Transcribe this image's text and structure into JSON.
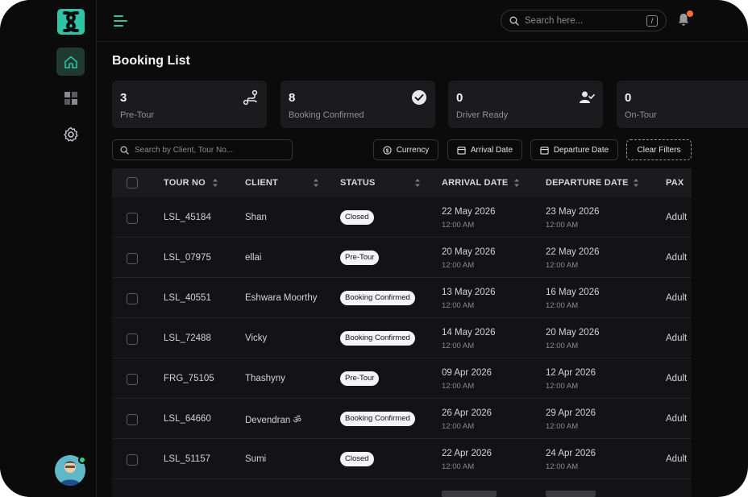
{
  "app": {
    "search_placeholder": "Search here...",
    "shortcut_key": "/"
  },
  "page": {
    "title": "Booking List"
  },
  "stats": [
    {
      "value": "3",
      "label": "Pre-Tour",
      "icon": "route-icon"
    },
    {
      "value": "8",
      "label": "Booking Confirmed",
      "icon": "check-circle-icon"
    },
    {
      "value": "0",
      "label": "Driver Ready",
      "icon": "user-check-icon"
    },
    {
      "value": "0",
      "label": "On-Tour",
      "icon": ""
    }
  ],
  "filters": {
    "search_placeholder": "Search by Client, Tour No...",
    "currency": "Currency",
    "arrival_date": "Arrival Date",
    "departure_date": "Departure Date",
    "clear": "Clear Filters"
  },
  "table": {
    "columns": [
      "TOUR NO",
      "CLIENT",
      "STATUS",
      "ARRIVAL DATE",
      "DEPARTURE DATE",
      "PAX"
    ],
    "rows": [
      {
        "tour_no": "LSL_45184",
        "client": "Shan",
        "status": "Closed",
        "arrival_date": "22 May 2026",
        "arrival_time": "12:00 AM",
        "departure_date": "23 May 2026",
        "departure_time": "12:00 AM",
        "pax": "Adult"
      },
      {
        "tour_no": "LSL_07975",
        "client": "ellai",
        "status": "Pre-Tour",
        "arrival_date": "20 May 2026",
        "arrival_time": "12:00 AM",
        "departure_date": "22 May 2026",
        "departure_time": "12:00 AM",
        "pax": "Adult"
      },
      {
        "tour_no": "LSL_40551",
        "client": "Eshwara Moorthy",
        "status": "Booking Confirmed",
        "arrival_date": "13 May 2026",
        "arrival_time": "12:00 AM",
        "departure_date": "16 May 2026",
        "departure_time": "12:00 AM",
        "pax": "Adult"
      },
      {
        "tour_no": "LSL_72488",
        "client": "Vicky",
        "status": "Booking Confirmed",
        "arrival_date": "14 May 2026",
        "arrival_time": "12:00 AM",
        "departure_date": "20 May 2026",
        "departure_time": "12:00 AM",
        "pax": "Adult"
      },
      {
        "tour_no": "FRG_75105",
        "client": "Thashyny",
        "status": "Pre-Tour",
        "arrival_date": "09 Apr 2026",
        "arrival_time": "12:00 AM",
        "departure_date": "12 Apr 2026",
        "departure_time": "12:00 AM",
        "pax": "Adult"
      },
      {
        "tour_no": "LSL_64660",
        "client": "Devendran ॐ",
        "status": "Booking Confirmed",
        "arrival_date": "26 Apr 2026",
        "arrival_time": "12:00 AM",
        "departure_date": "29 Apr 2026",
        "departure_time": "12:00 AM",
        "pax": "Adult"
      },
      {
        "tour_no": "LSL_51157",
        "client": "Sumi",
        "status": "Closed",
        "arrival_date": "22 Apr 2026",
        "arrival_time": "12:00 AM",
        "departure_date": "24 Apr 2026",
        "departure_time": "12:00 AM",
        "pax": "Adult"
      }
    ]
  },
  "colors": {
    "background": "#0b0b0c",
    "card": "#1b1b1e",
    "accent": "#2fc4a4",
    "notification": "#ff6a3d",
    "online": "#2fd18a"
  }
}
